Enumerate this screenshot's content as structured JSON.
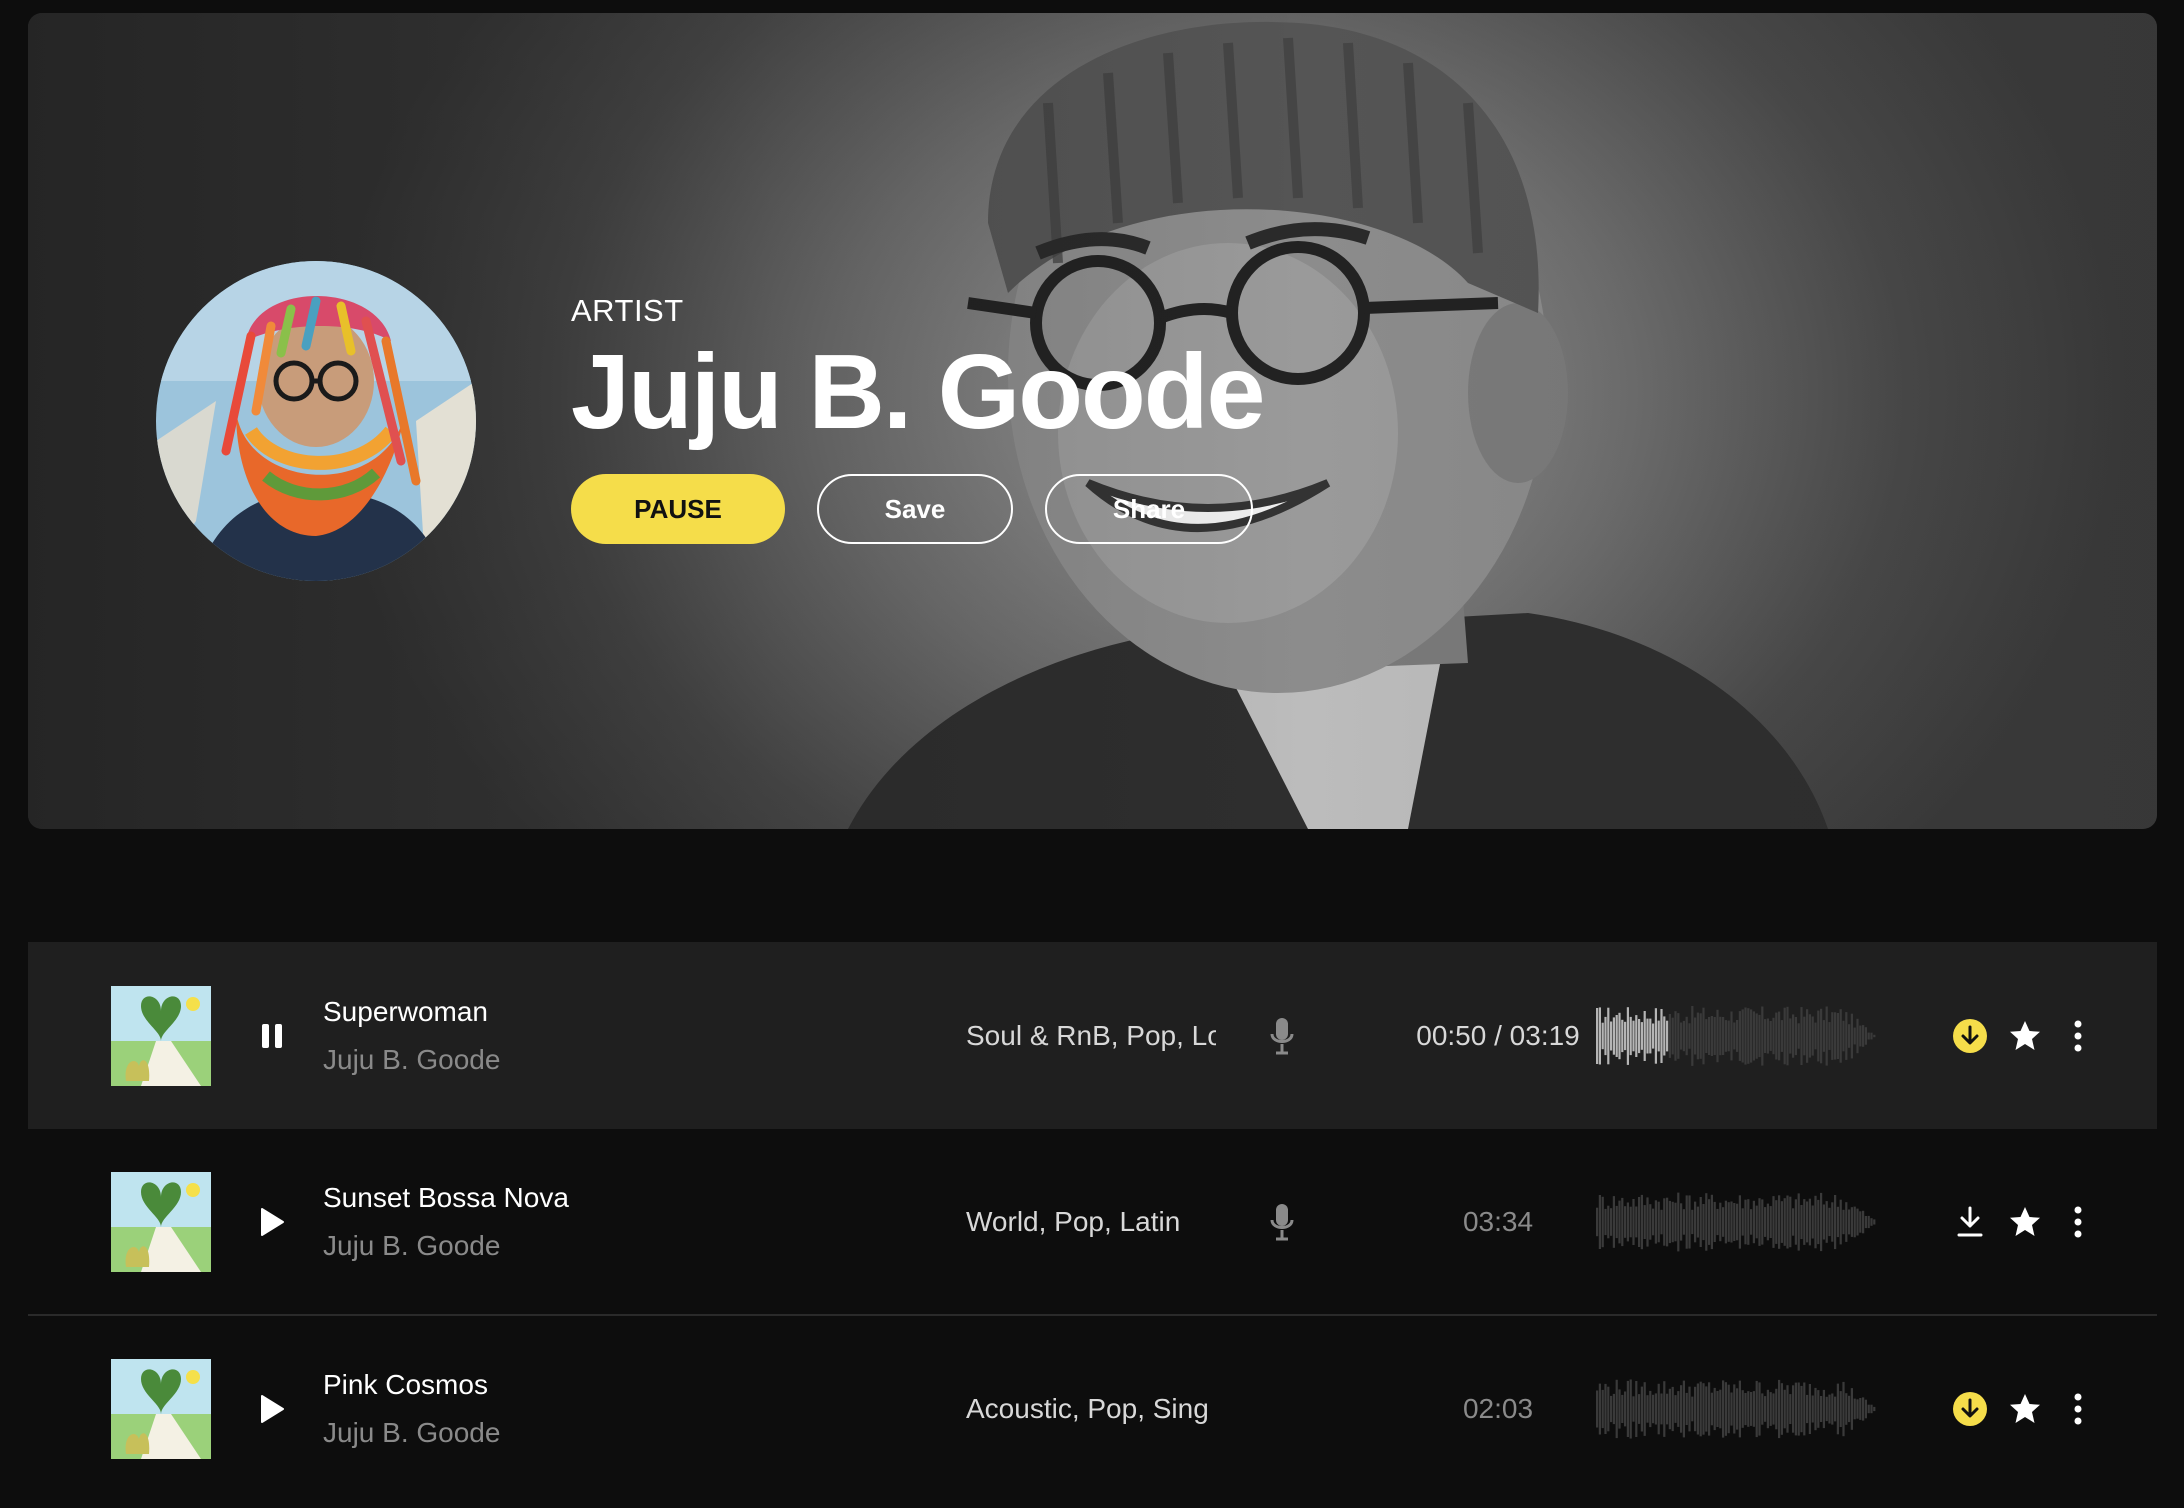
{
  "artist": {
    "eyebrow": "ARTIST",
    "name": "Juju B. Goode"
  },
  "buttons": {
    "pause": "PAUSE",
    "save": "Save",
    "share": "Share"
  },
  "colors": {
    "accent": "#f5dd4a",
    "background": "#0d0d0d",
    "active_row": "#1f1f1f"
  },
  "tracks": [
    {
      "title": "Superwoman",
      "artist": "Juju B. Goode",
      "genres": "Soul & RnB, Pop, Lo",
      "current_time": "00:50",
      "separator": " / ",
      "duration": "03:19",
      "state": "playing",
      "play_icon": "pause-icon",
      "has_vocals": true,
      "downloaded": true,
      "progress": 0.26
    },
    {
      "title": "Sunset Bossa Nova",
      "artist": "Juju B. Goode",
      "genres": "World, Pop, Latin",
      "duration": "03:34",
      "state": "paused",
      "play_icon": "play-icon",
      "has_vocals": true,
      "downloaded": false,
      "progress": 0
    },
    {
      "title": "Pink Cosmos",
      "artist": "Juju B. Goode",
      "genres": "Acoustic, Pop, Sing",
      "duration": "02:03",
      "state": "paused",
      "play_icon": "play-icon",
      "has_vocals": false,
      "downloaded": true,
      "progress": 0
    }
  ]
}
